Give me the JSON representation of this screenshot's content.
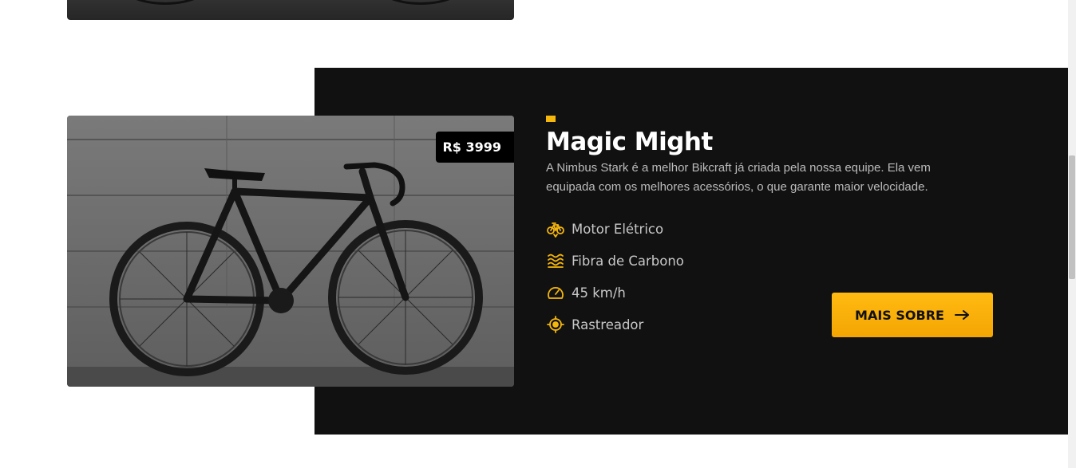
{
  "product": {
    "name": "Magic Might",
    "price": "R$ 3999",
    "description": "A Nimbus Stark é a melhor Bikcraft já criada pela nossa equipe. Ela vem equipada com os melhores acessórios, o que garante maior velocidade.",
    "features": [
      {
        "icon": "bike-icon",
        "label": "Motor Elétrico"
      },
      {
        "icon": "waves-icon",
        "label": "Fibra de Carbono"
      },
      {
        "icon": "speedometer-icon",
        "label": "45 km/h"
      },
      {
        "icon": "target-icon",
        "label": "Rastreador"
      }
    ],
    "button_label": "MAIS SOBRE"
  },
  "colors": {
    "accent": "#f5b60d",
    "panel": "#111111",
    "button_top": "#ffbb11",
    "button_bottom": "#f4a503"
  }
}
